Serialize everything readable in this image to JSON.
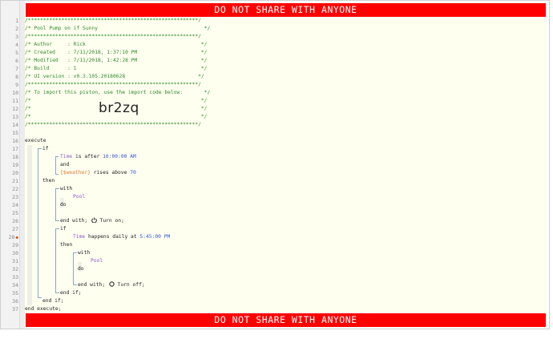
{
  "banner": {
    "top": "DO NOT SHARE WITH ANYONE",
    "bottom": "DO NOT SHARE WITH ANYONE"
  },
  "line_numbers": [
    "1",
    "2",
    "3",
    "4",
    "5",
    "6",
    "7",
    "8",
    "9",
    "10",
    "11",
    "12",
    "13",
    "14",
    "15",
    "16",
    "17",
    "18",
    "19",
    "20",
    "21",
    "22",
    "23",
    "24",
    "25",
    "26",
    "27",
    "28",
    "29",
    "30",
    "31",
    "32",
    "33",
    "34",
    "35",
    "36",
    "37"
  ],
  "header": {
    "stars": "/********************************************************/",
    "title": "/* Pool Pump on if Sunny                                   */",
    "author": "/* Author     : Rick                                      */",
    "created": "/* Created    : 7/11/2018, 1:37:10 PM                     */",
    "modified": "/* Modified   : 7/11/2018, 1:42:28 PM                     */",
    "build": "/* Build      : 1                                         */",
    "ui_version": "/* UI version : v0.3.105.20180628                        */",
    "import_hint": "/* To import this piston, use the import code below:       */",
    "blank": "/*                                                        */",
    "blank_end": "*/",
    "import_code": "br2zq"
  },
  "code": {
    "execute": "execute",
    "if1": "if",
    "time1": "Time",
    "is_after": " is after ",
    "time1_value": "10:00:00 AM",
    "and": "and",
    "weather": "{$weather}",
    "rises_above": " rises above ",
    "threshold": "70",
    "then1": "then",
    "with1": "with",
    "device1": "Pool",
    "do1": "do",
    "turn_on": "Turn on;",
    "end_with1": "end with;",
    "if2": "if",
    "time2": "Time",
    "happens_daily": " happens daily at ",
    "time2_value": "5:45:00 PM",
    "then2": "then",
    "with2": "with",
    "device2": "Pool",
    "do2": "do",
    "turn_off": "Turn off;",
    "end_with2": "end with;",
    "end_if2": "end if;",
    "end_if1": "end if;",
    "end_execute": "end execute;"
  }
}
